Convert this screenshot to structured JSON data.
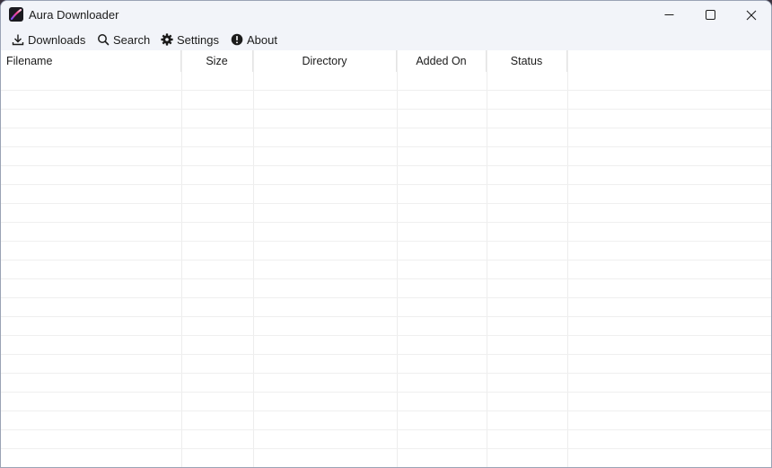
{
  "window": {
    "title": "Aura Downloader"
  },
  "menu": {
    "downloads": "Downloads",
    "search": "Search",
    "settings": "Settings",
    "about": "About"
  },
  "table": {
    "columns": [
      "Filename",
      "Size",
      "Directory",
      "Added On",
      "Status"
    ],
    "rows": []
  },
  "icons": {
    "app": "app-logo-icon",
    "downloads": "download-icon",
    "search": "search-icon",
    "settings": "gear-icon",
    "about": "info-icon",
    "minimize": "minimize-icon",
    "maximize": "maximize-icon",
    "close": "close-icon"
  },
  "colors": {
    "titlebar_bg": "#f2f4f9",
    "gridline": "#ededed",
    "text": "#1b1b1b"
  }
}
